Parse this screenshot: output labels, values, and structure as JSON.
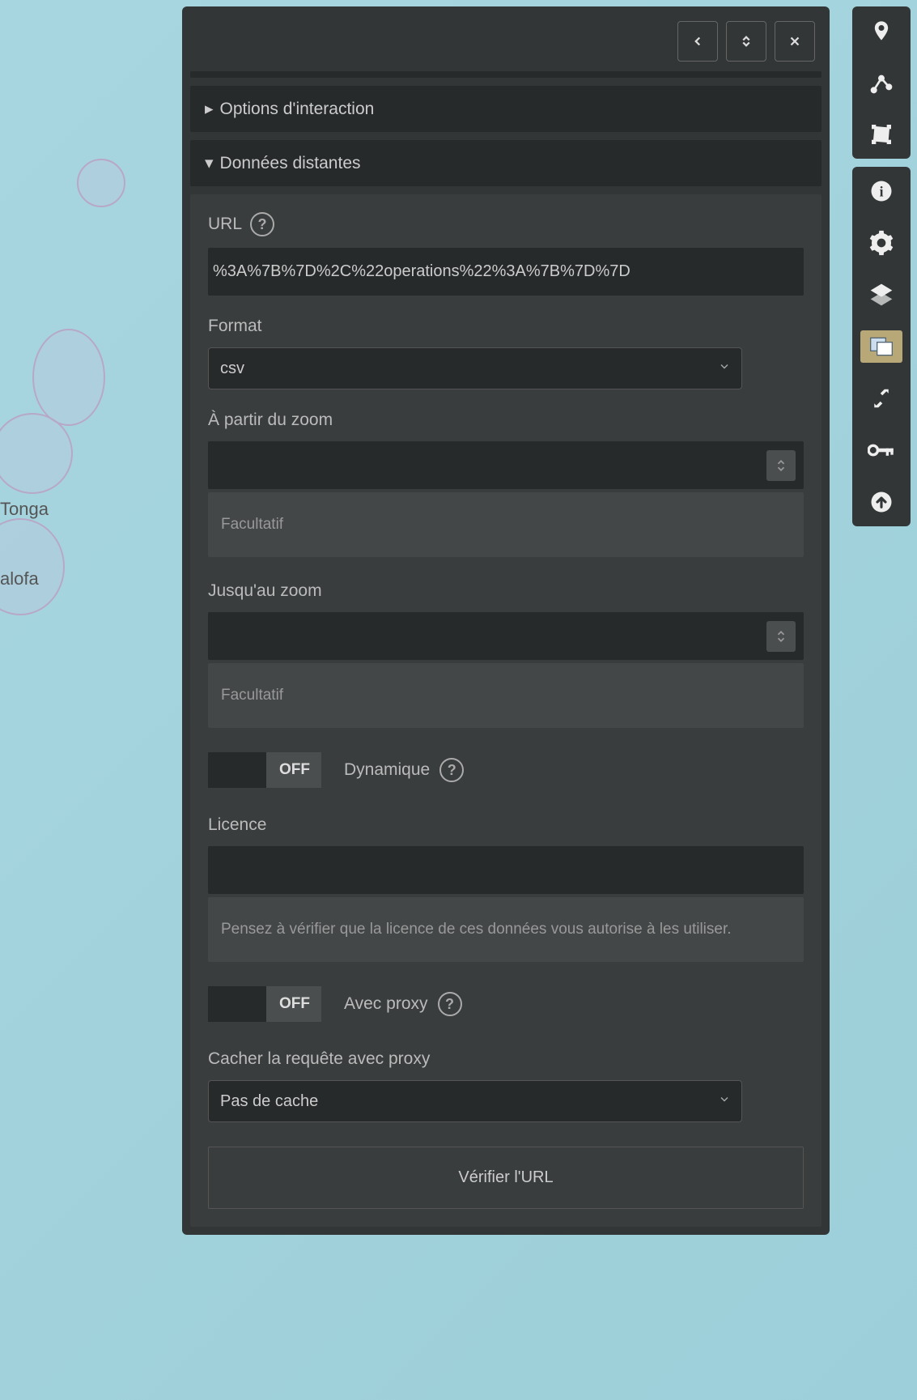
{
  "map": {
    "label_tonga": "Tonga",
    "label_alofa": "alofa"
  },
  "sections": {
    "interaction": "Options d'interaction",
    "remote": "Données distantes"
  },
  "form": {
    "url_label": "URL",
    "url_value": "%3A%7B%7D%2C%22operations%22%3A%7B%7D%7D",
    "format_label": "Format",
    "format_value": "csv",
    "from_zoom_label": "À partir du zoom",
    "from_zoom_value": "",
    "from_zoom_hint": "Facultatif",
    "until_zoom_label": "Jusqu'au zoom",
    "until_zoom_value": "",
    "until_zoom_hint": "Facultatif",
    "dynamic_label": "Dynamique",
    "dynamic_state": "OFF",
    "licence_label": "Licence",
    "licence_value": "",
    "licence_hint": "Pensez à vérifier que la licence de ces données vous autorise à les utiliser.",
    "proxy_label": "Avec proxy",
    "proxy_state": "OFF",
    "cache_label": "Cacher la requête avec proxy",
    "cache_value": "Pas de cache",
    "verify_button": "Vérifier l'URL"
  }
}
